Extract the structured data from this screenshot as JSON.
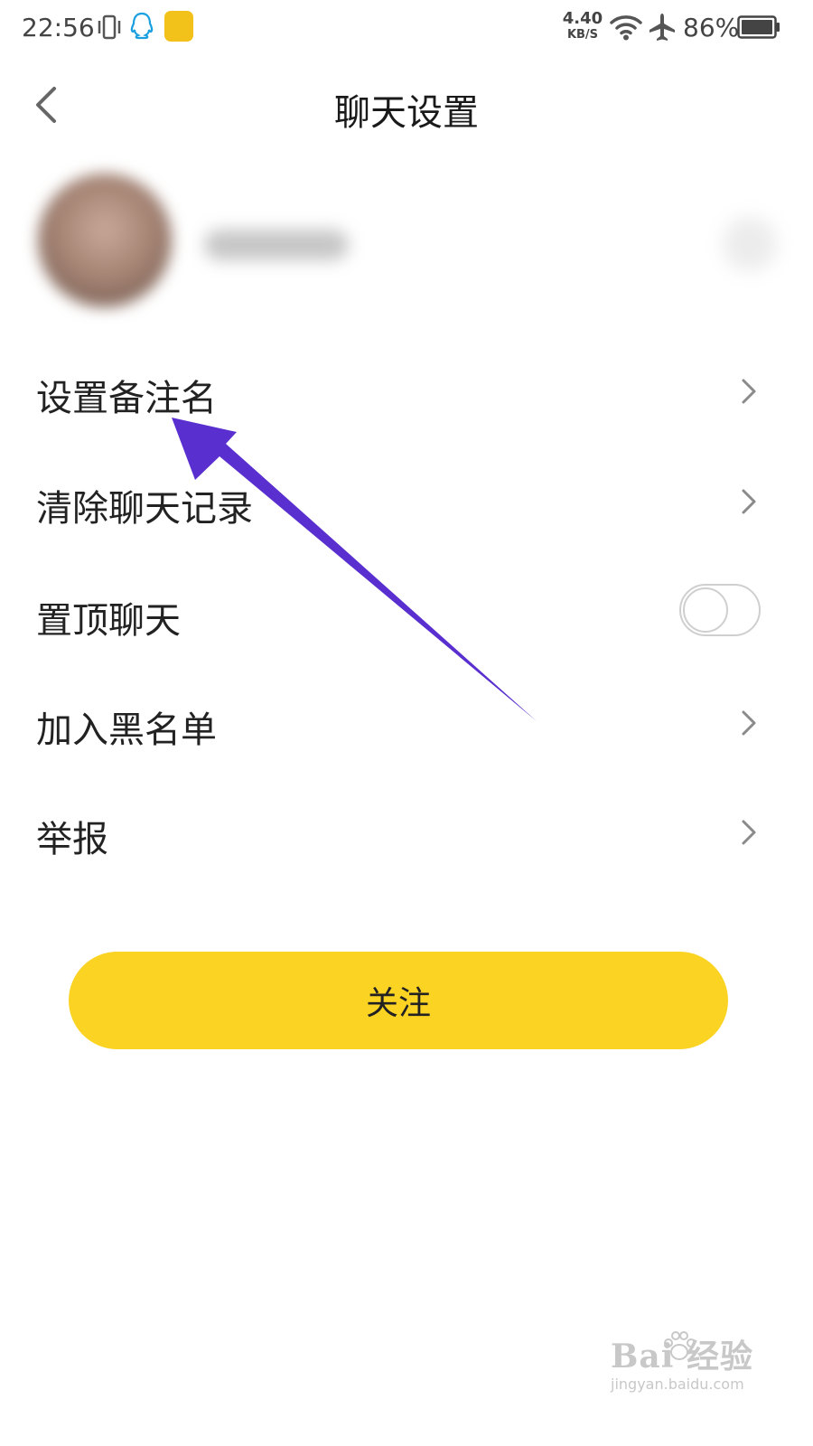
{
  "status_bar": {
    "time": "22:56",
    "net_speed_value": "4.40",
    "net_speed_unit": "KB/S",
    "battery_percent": "86%"
  },
  "nav": {
    "title": "聊天设置"
  },
  "menu": {
    "items": [
      {
        "label": "设置备注名",
        "control": "chevron"
      },
      {
        "label": "清除聊天记录",
        "control": "chevron"
      },
      {
        "label": "置顶聊天",
        "control": "toggle",
        "toggle_on": false
      },
      {
        "label": "加入黑名单",
        "control": "chevron"
      },
      {
        "label": "举报",
        "control": "chevron"
      }
    ]
  },
  "follow_button": {
    "label": "关注"
  },
  "annotation": {
    "arrow_color": "#5a2fd0"
  },
  "colors": {
    "accent": "#fbd322"
  },
  "watermark": {
    "logo": "Bai  经验",
    "url": "jingyan.baidu.com"
  }
}
